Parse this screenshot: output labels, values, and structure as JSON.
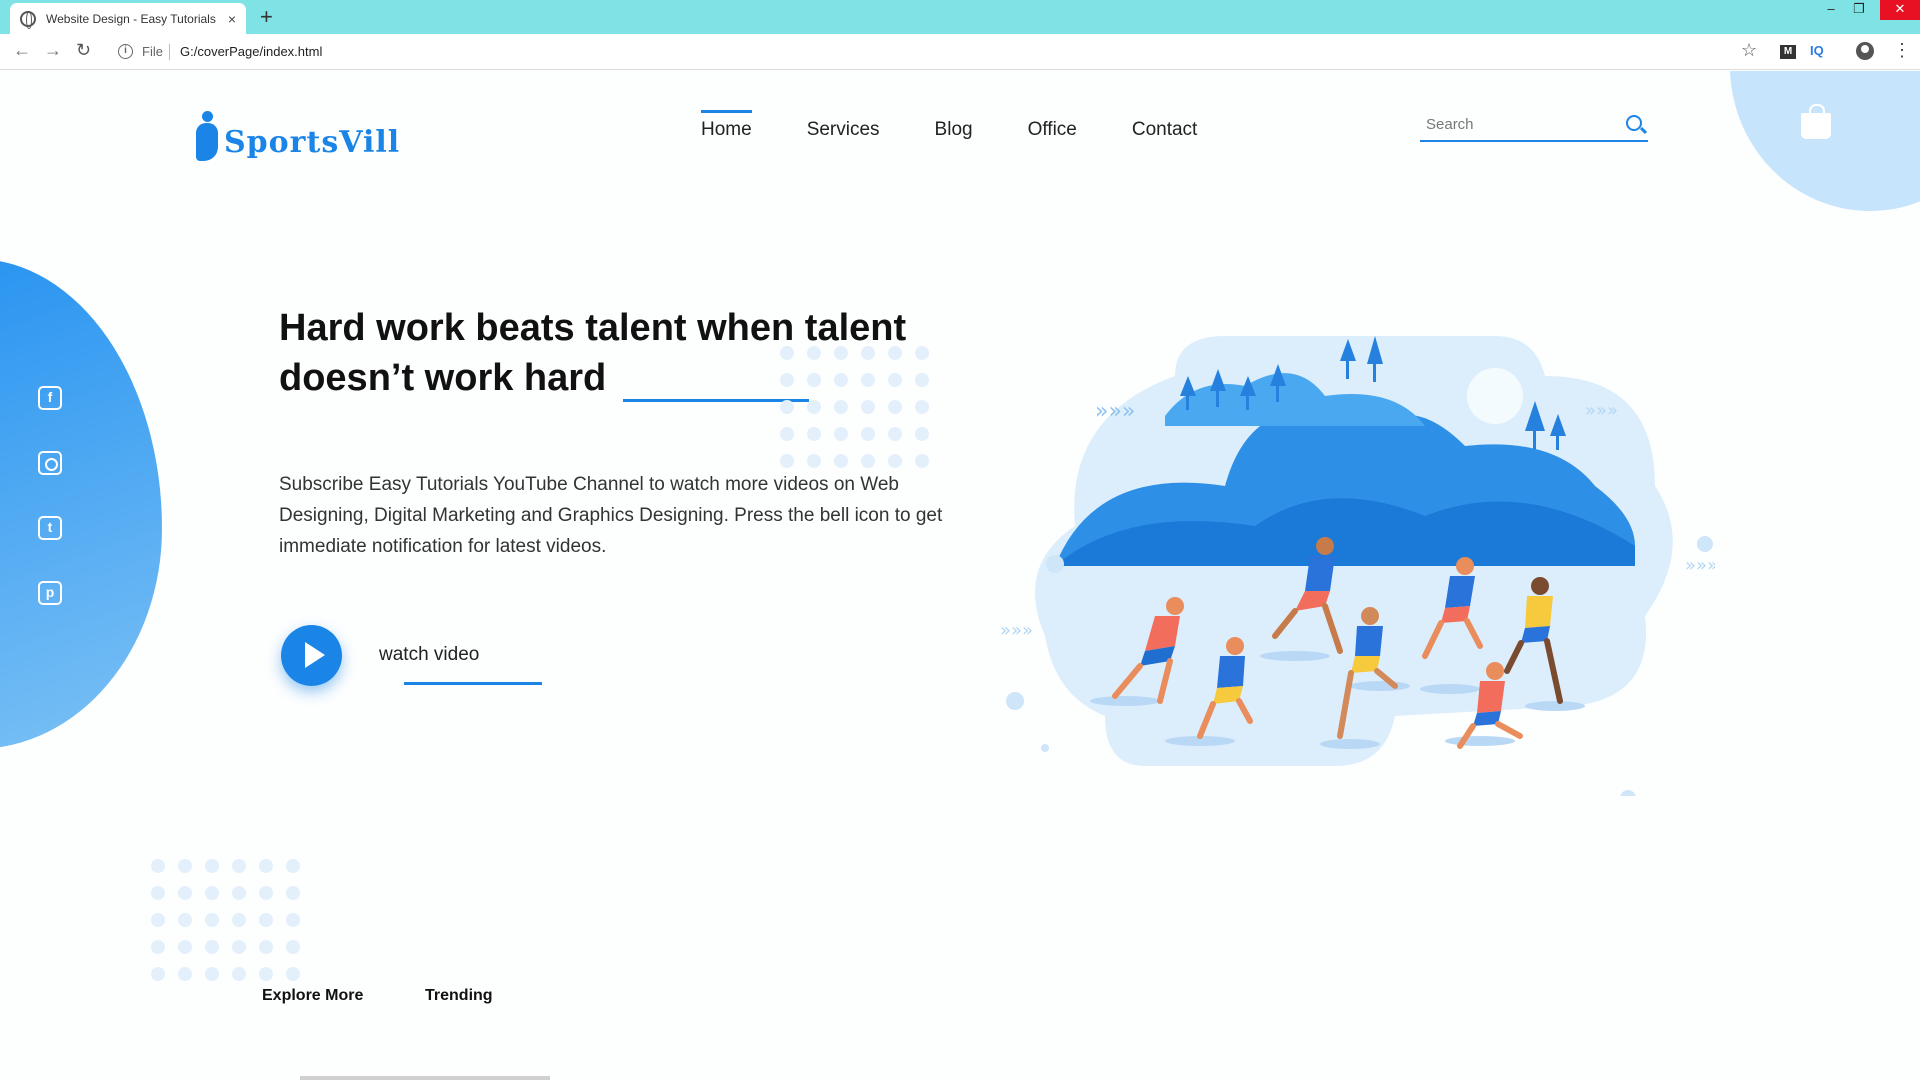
{
  "browser": {
    "tab_title": "Website Design - Easy Tutorials",
    "tab_close": "×",
    "new_tab": "+",
    "address_prefix": "File",
    "url": "G:/coverPage/index.html",
    "ext_m": "M",
    "ext_iq": "IQ",
    "win_min": "–",
    "win_max": "❐",
    "win_close": "✕"
  },
  "site": {
    "logo_text": "SportsVill",
    "brand_color": "#1a85e6",
    "nav": [
      {
        "label": "Home",
        "active": true
      },
      {
        "label": "Services"
      },
      {
        "label": "Blog"
      },
      {
        "label": "Office"
      },
      {
        "label": "Contact"
      }
    ],
    "search": {
      "placeholder": "Search"
    },
    "social_icons": [
      "facebook-icon",
      "instagram-icon",
      "twitter-icon",
      "pinterest-icon"
    ]
  },
  "hero": {
    "title": "Hard work beats talent when talent doesn’t work hard",
    "description": "Subscribe Easy Tutorials YouTube Channel to watch more videos on Web Designing, Digital Marketing and Graphics Designing. Press the bell icon to get immediate notification for latest videos.",
    "watch_label": "watch video"
  },
  "bottom_links": {
    "explore": "Explore More",
    "trending": "Trending"
  }
}
